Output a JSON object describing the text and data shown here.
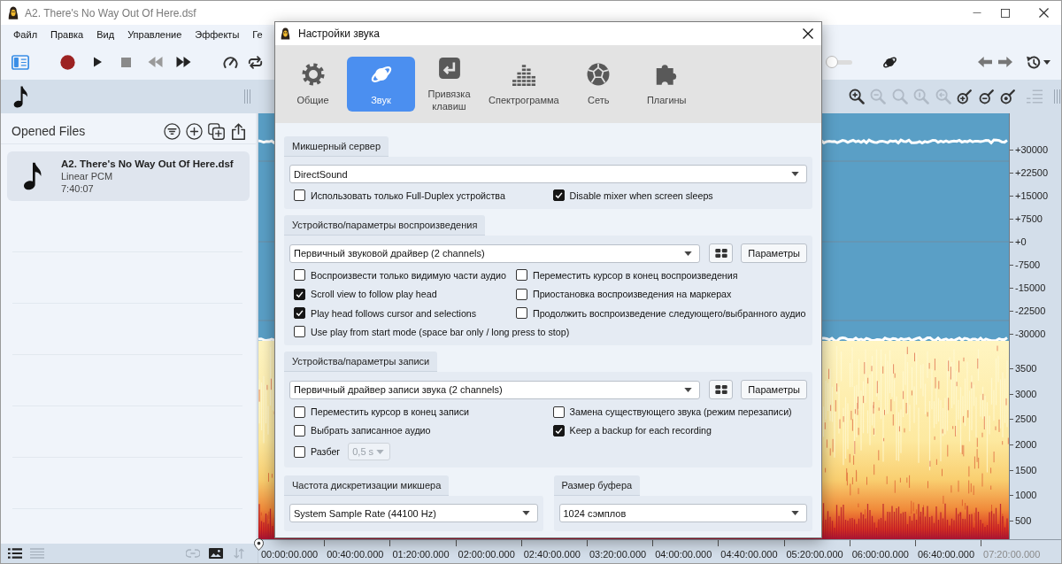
{
  "window": {
    "title": "A2. There's No Way Out Of Here.dsf"
  },
  "menu": [
    "Файл",
    "Правка",
    "Вид",
    "Управление",
    "Эффекты",
    "Ге"
  ],
  "toolbar": {
    "slider": {
      "level": 0
    }
  },
  "view_toolbar": {
    "tools": [
      {
        "disabled": false
      },
      {
        "disabled": true
      },
      {
        "disabled": true
      },
      {
        "disabled": true
      },
      {
        "disabled": true
      },
      {
        "disabled": false
      },
      {
        "disabled": false
      },
      {
        "disabled": false
      },
      {
        "disabled": true
      }
    ]
  },
  "sidebar": {
    "title": "Opened Files",
    "files": [
      {
        "name": "A2. There's No Way Out Of Here.dsf",
        "format": "Linear PCM",
        "duration": "7:40:07",
        "selected": true
      }
    ]
  },
  "bottom_bar": {
    "left_tools": [
      {
        "disabled": false
      },
      {
        "disabled": true
      }
    ],
    "right_tools": [
      {
        "disabled": true
      },
      {
        "disabled": false
      },
      {
        "disabled": true
      }
    ]
  },
  "editor": {
    "amplitude_scale": [
      "+30000",
      "+22500",
      "+15000",
      "+7500",
      "+0",
      "-7500",
      "-15000",
      "-22500",
      "-30000"
    ],
    "frequency_scale": [
      "3500",
      "3000",
      "2500",
      "2000",
      "1500",
      "1000",
      "500"
    ],
    "time_ruler": [
      "00:00:00.000",
      "00:40:00.000",
      "01:20:00.000",
      "02:00:00.000",
      "02:40:00.000",
      "03:20:00.000",
      "04:00:00.000",
      "04:40:00.000",
      "05:20:00.000",
      "06:00:00.000",
      "06:40:00.000",
      "07:20:00.000"
    ]
  },
  "dialog": {
    "title": "Настройки звука",
    "tabs": [
      {
        "label": "Общие",
        "selected": false
      },
      {
        "label": "Звук",
        "selected": true
      },
      {
        "label": "Привязка клавиш",
        "selected": false
      },
      {
        "label": "Спектрограмма",
        "selected": false
      },
      {
        "label": "Сеть",
        "selected": false
      },
      {
        "label": "Плагины",
        "selected": false
      }
    ],
    "sections": [
      {
        "title": "Микшерный сервер",
        "dropdown": "DirectSound",
        "options": [
          {
            "label": "Использовать только Full-Duplex устройства",
            "checked": false
          },
          {
            "label": "Disable mixer when screen sleeps",
            "checked": true
          }
        ]
      },
      {
        "title": "Устройство/параметры воспроизведения",
        "dropdown": "Первичный звуковой драйвер (2 channels)",
        "button": "Параметры",
        "options": [
          {
            "label": "Воспроизвести только видимую части аудио",
            "checked": false
          },
          {
            "label": "Переместить курсор в конец воспроизведения",
            "checked": false
          },
          {
            "label": "Scroll view to follow play head",
            "checked": true
          },
          {
            "label": "Приостановка воспроизведения на маркерах",
            "checked": false
          },
          {
            "label": "Play head follows cursor and selections",
            "checked": true
          },
          {
            "label": "Продолжить воспроизведение следующего/выбранного аудио",
            "checked": false
          },
          {
            "label": "Use play from start mode (space bar only / long press to stop)",
            "checked": false
          }
        ]
      },
      {
        "title": "Устройства/параметры записи",
        "dropdown": "Первичный драйвер записи звука (2 channels)",
        "button": "Параметры",
        "options": [
          {
            "label": "Переместить курсор в конец записи",
            "checked": false
          },
          {
            "label": "Замена существующего звука (режим перезаписи)",
            "checked": false
          },
          {
            "label": "Выбрать записанное аудио",
            "checked": false
          },
          {
            "label": "Keep a backup for each recording",
            "checked": true
          },
          {
            "label": "Разбег",
            "checked": false,
            "select": {
              "value": "0,5 s",
              "disabled": true
            }
          }
        ]
      }
    ],
    "footer_groups": [
      {
        "title": "Частота дискретизации микшера",
        "dropdown": "System Sample Rate (44100 Hz)"
      },
      {
        "title": "Размер буфера",
        "dropdown": "1024 сэмплов"
      }
    ]
  }
}
